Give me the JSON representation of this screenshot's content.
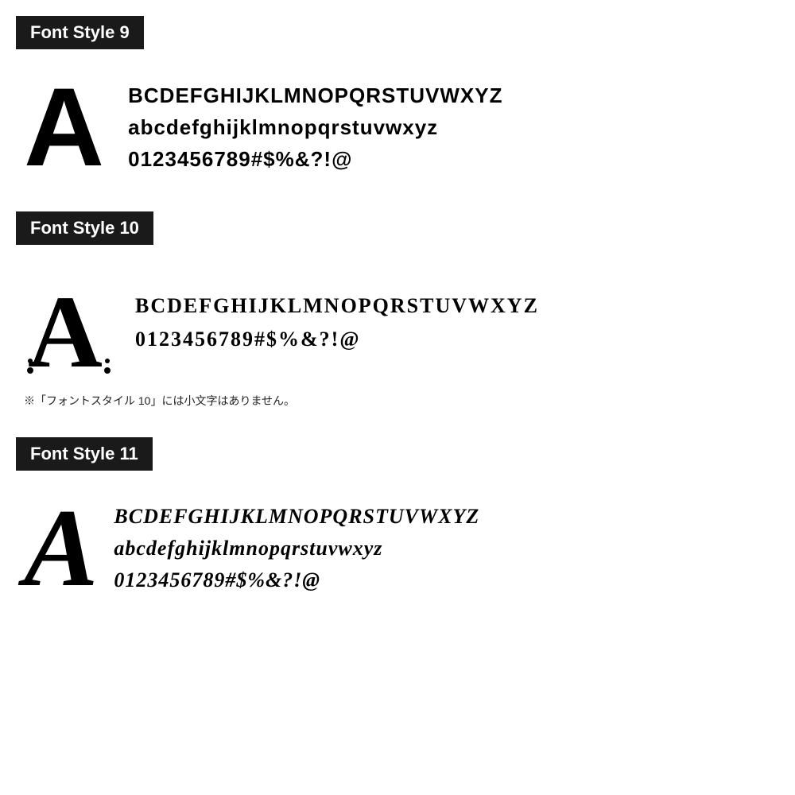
{
  "sections": [
    {
      "id": "font-style-9",
      "header_label": "Font Style 9",
      "big_letter": "A",
      "lines": [
        "BCDEFGHIJKLMNOPQRSTUVWXYZ",
        "abcdefghijklmnopqrstuvwxyz",
        "0123456789#$%&?!@"
      ]
    },
    {
      "id": "font-style-10",
      "header_label": "Font Style 10",
      "big_letter": "A",
      "lines": [
        "BCDEFGHIJKLMNOPQRSTUVWXYZ",
        "0123456789#$%&?!@"
      ],
      "note": "※「フォントスタイル 10」には小文字はありません。"
    },
    {
      "id": "font-style-11",
      "header_label": "Font Style 11",
      "big_letter": "A",
      "lines": [
        "BCDEFGHIJKLMNOPQRSTUVWXYZ",
        "abcdefghijklmnopqrstuvwxyz",
        "0123456789#$%&?!@"
      ]
    }
  ]
}
